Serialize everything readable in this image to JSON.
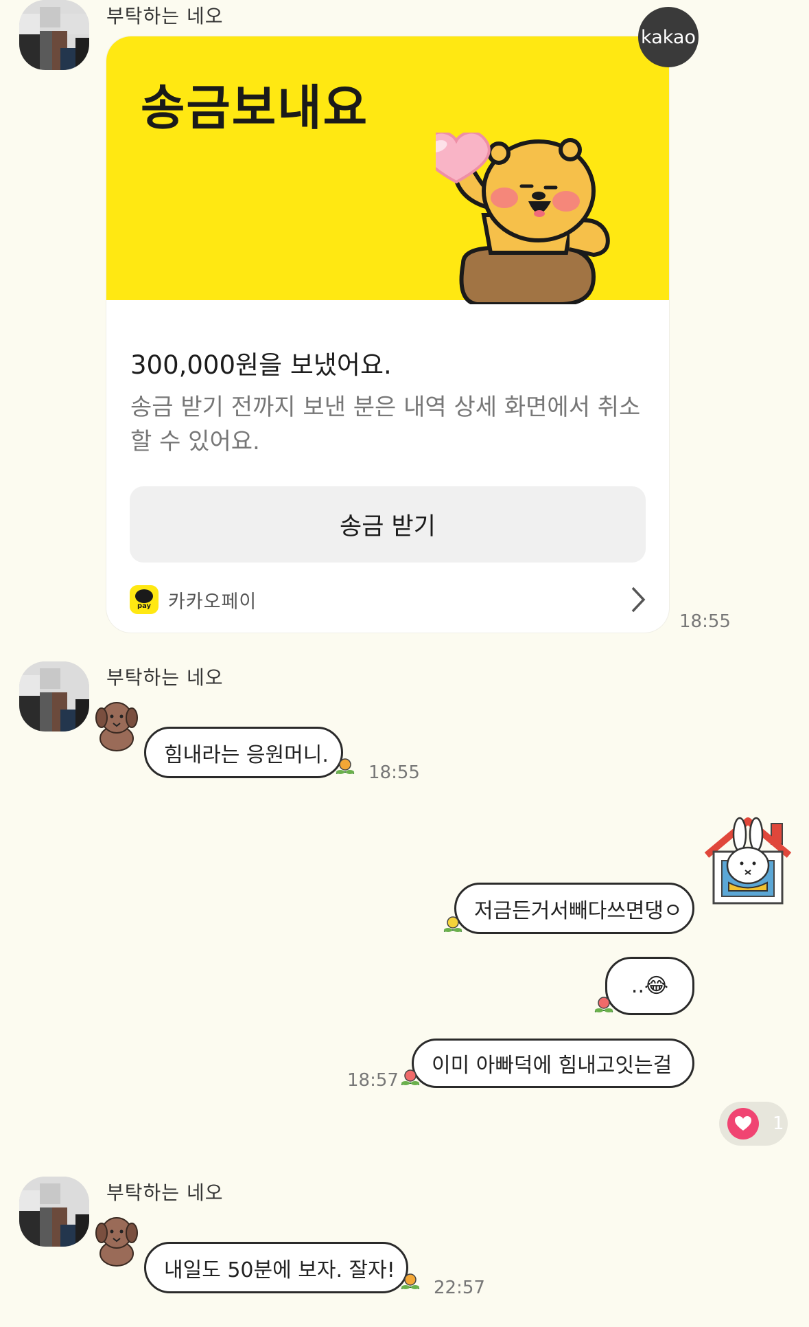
{
  "messages": [
    {
      "sender": "부탁하는 네오"
    },
    {
      "sender": "부탁하는 네오",
      "text": "힘내라는 응원머니.",
      "time": "18:55"
    },
    {
      "sender": "부탁하는 네오",
      "text": "내일도 50분에 보자. 잘자!",
      "time": "22:57"
    }
  ],
  "transfer_card": {
    "title": "송금보내요",
    "amount_text": "300,000원을 보냈어요.",
    "description": "송금 받기 전까지 보낸 분은 내역 상세 화면에서 취소할 수 있어요.",
    "button_label": "송금 받기",
    "provider": "카카오페이",
    "provider_icon_text": "pay",
    "badge": "kakao",
    "time": "18:55"
  },
  "my_messages": [
    {
      "text": "저금든거서빼다쓰면댕ㅇ"
    },
    {
      "text": "..😂"
    },
    {
      "text": "이미 아빠덕에 힘내고잇는걸",
      "time": "18:57"
    }
  ],
  "reaction": {
    "icon": "heart-icon",
    "count": "1",
    "color": "#f04472"
  },
  "colors": {
    "background": "#fcfbf0",
    "kakao_yellow": "#ffe812"
  }
}
